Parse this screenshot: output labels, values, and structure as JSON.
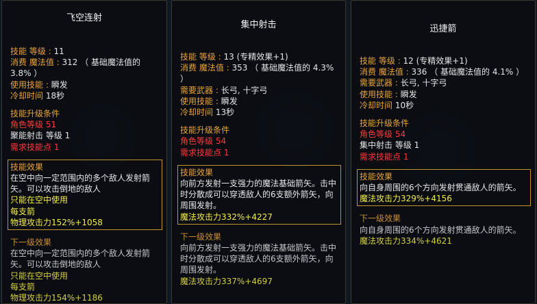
{
  "panels": [
    {
      "title": "飞空连射",
      "info": [
        {
          "label": "技能 等级 : ",
          "value": "11"
        },
        {
          "label": "消费 魔法值 : ",
          "value": "312 （ 基础魔法值的 3.8% ）"
        },
        {
          "label": "使用技能 : ",
          "value": "瞬发"
        },
        {
          "label": "冷却时间 ",
          "value": "18秒"
        }
      ],
      "upgrade": {
        "header": "技能升级条件",
        "lines": [
          {
            "text": "角色等级 51",
            "color": "red"
          },
          {
            "text": "聚能射击 等级 1",
            "color": "white"
          },
          {
            "text": "需求技能点 1",
            "color": "red"
          }
        ]
      },
      "effect": {
        "header": "技能效果",
        "lines": [
          {
            "text": "在空中向一定范围内的多个敌人发射箭矢。可以攻击倒地的敌人",
            "color": "white"
          },
          {
            "text": "只能在空中使用",
            "color": "yellow"
          },
          {
            "text": "每支箭",
            "color": "yellow"
          },
          {
            "text": "物理攻击力152%+1058",
            "color": "yellow"
          }
        ]
      },
      "next": {
        "header": "下一级效果",
        "lines": [
          {
            "text": "在空中向一定范围内的多个敌人发射箭矢。可以攻击倒地的敌人",
            "color": "white"
          },
          {
            "text": "只能在空中使用",
            "color": "yellow"
          },
          {
            "text": "每支箭",
            "color": "yellow"
          },
          {
            "text": "物理攻击力154%+1186",
            "color": "yellow"
          }
        ]
      }
    },
    {
      "title": "集中射击",
      "info": [
        {
          "label": "技能 等级 : ",
          "value": "13 (专精效果+1)"
        },
        {
          "label": "消费 魔法值 : ",
          "value": "353 （ 基础魔法值的 4.3% ）"
        },
        {
          "label": "需要武器 : ",
          "value": "长弓, 十字弓"
        },
        {
          "label": "使用技能 : ",
          "value": "瞬发"
        },
        {
          "label": "冷却时间 ",
          "value": "13秒"
        }
      ],
      "upgrade": {
        "header": "技能升级条件",
        "lines": [
          {
            "text": "角色等级 54",
            "color": "red"
          },
          {
            "text": "需求技能点 1",
            "color": "red"
          }
        ]
      },
      "effect": {
        "header": "技能效果",
        "lines": [
          {
            "text": "向前方发射一支强力的魔法基础箭矢。击中时分散成可以穿透敌人的6支额外箭矢，向周围发射。",
            "color": "white"
          },
          {
            "text": "魔法攻击力332%+4227",
            "color": "yellow"
          }
        ]
      },
      "next": {
        "header": "下一级效果",
        "lines": [
          {
            "text": "向前方发射一支强力的魔法基础箭矢。击中时分散成可以穿透敌人的6支额外箭矢，向周围发射。",
            "color": "white"
          },
          {
            "text": "魔法攻击力337%+4697",
            "color": "yellow"
          }
        ]
      }
    },
    {
      "title": "迅捷箭",
      "info": [
        {
          "label": "技能 等级 : ",
          "value": "12 (专精效果+1)"
        },
        {
          "label": "消费 魔法值 : ",
          "value": "336 （ 基础魔法值的 4.1% ）"
        },
        {
          "label": "需要武器 : ",
          "value": "长弓, 十字弓"
        },
        {
          "label": "使用技能 : ",
          "value": "瞬发"
        },
        {
          "label": "冷却时间 ",
          "value": "10秒"
        }
      ],
      "upgrade": {
        "header": "技能升级条件",
        "lines": [
          {
            "text": "角色等级 54",
            "color": "red"
          },
          {
            "text": "集中射击 等级 1",
            "color": "white"
          },
          {
            "text": "需求技能点 1",
            "color": "red"
          }
        ]
      },
      "effect": {
        "header": "技能效果",
        "lines": [
          {
            "text": "向自身周围的6个方向发射贯通敌人的箭矢。",
            "color": "white"
          },
          {
            "text": "魔法攻击力329%+4156",
            "color": "yellow"
          }
        ]
      },
      "next": {
        "header": "下一级效果",
        "lines": [
          {
            "text": "向自身周围的6个方向发射贯通敌人的箭矢。",
            "color": "white"
          },
          {
            "text": "魔法攻击力334%+4621",
            "color": "yellow"
          }
        ]
      }
    }
  ],
  "colors": {
    "label": "#e8a43a",
    "requirement": "#ff3a3a",
    "effect_value": "#f3ee4e",
    "text": "#e6e6e6",
    "effect_border": "#c0952e"
  }
}
